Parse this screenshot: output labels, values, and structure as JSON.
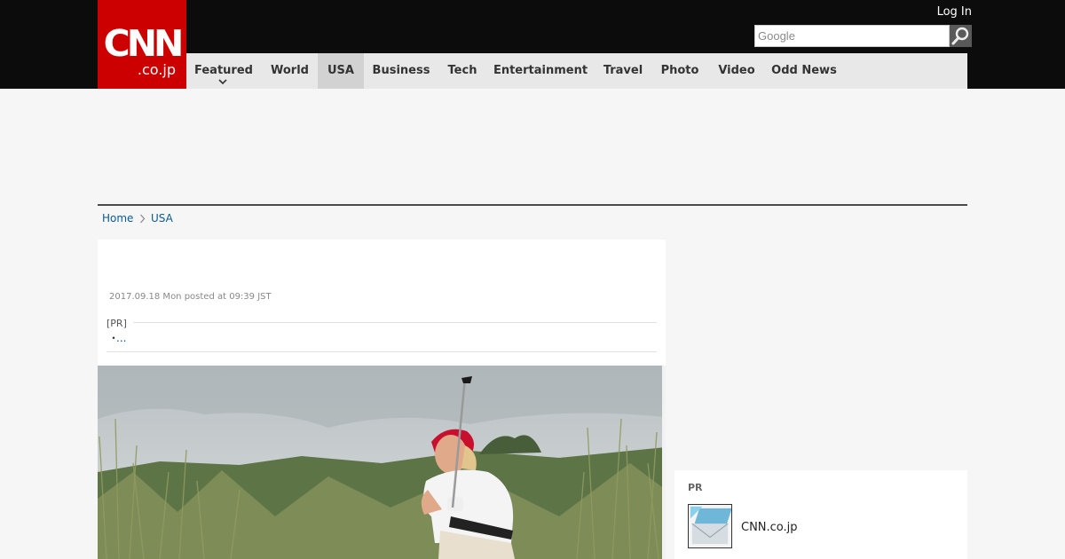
{
  "header": {
    "logo_main": "CNN",
    "logo_sub": ".co.jp",
    "login_label": "Log In",
    "search_placeholder": "Google",
    "search_button_icon": "magnifier-icon"
  },
  "nav": {
    "items": [
      {
        "label": "Featured"
      },
      {
        "label": "World"
      },
      {
        "label": "USA",
        "active": true
      },
      {
        "label": "Business"
      },
      {
        "label": "Tech"
      },
      {
        "label": "Entertainment"
      },
      {
        "label": "Travel"
      },
      {
        "label": "Photo"
      },
      {
        "label": "Video"
      },
      {
        "label": "Odd News"
      }
    ]
  },
  "breadcrumb": {
    "home": "Home",
    "section": "USA"
  },
  "article": {
    "dateline": "2017.09.18 Mon posted at 09:39 JST",
    "pr_label": "[PR]",
    "pr_bullet": "・",
    "pr_link": "..."
  },
  "sidebar": {
    "pr_label": "PR",
    "item_label": "CNN.co.jp"
  },
  "colors": {
    "brand_red": "#cc0000",
    "header_black": "#0c0c0c",
    "nav_grey": "#e8e8e8",
    "link_blue": "#0a5a94"
  }
}
